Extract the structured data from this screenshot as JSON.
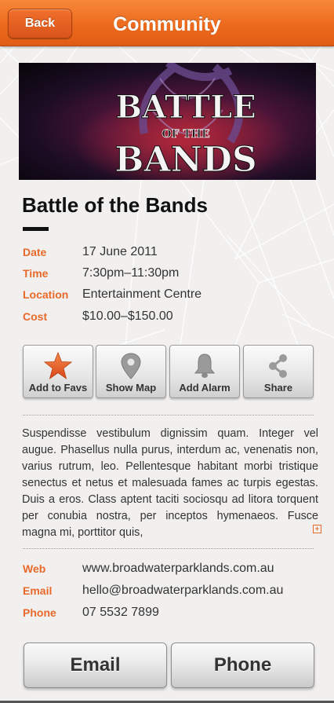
{
  "header": {
    "back_label": "Back",
    "title": "Community"
  },
  "banner": {
    "line1": "BATTLE",
    "line2": "OF THE",
    "line3": "BANDS"
  },
  "event": {
    "title": "Battle of the Bands",
    "details": [
      {
        "label": "Date",
        "value": "17 June 2011"
      },
      {
        "label": "Time",
        "value": "7:30pm–11:30pm"
      },
      {
        "label": "Location",
        "value": "Entertainment Centre"
      },
      {
        "label": "Cost",
        "value": "$10.00–$150.00"
      }
    ]
  },
  "actions": [
    {
      "label": "Add to Favs",
      "icon": "star-icon"
    },
    {
      "label": "Show Map",
      "icon": "map-pin-icon"
    },
    {
      "label": "Add Alarm",
      "icon": "bell-icon"
    },
    {
      "label": "Share",
      "icon": "share-icon"
    }
  ],
  "description": "Suspendisse vestibulum dignissim quam. Integer vel augue. Phasellus nulla purus, interdum ac, venenatis non, varius rutrum, leo. Pellentesque habitant morbi tristique senectus et netus et malesuada fames ac turpis egestas. Duis a eros. Class aptent taciti sociosqu ad litora torquent per conubia nostra, per inceptos hymenaeos. Fusce magna mi, porttitor quis,",
  "contact": [
    {
      "label": "Web",
      "value": "www.broadwaterparklands.com.au"
    },
    {
      "label": "Email",
      "value": "hello@broadwaterparklands.com.au"
    },
    {
      "label": "Phone",
      "value": "07 5532 7899"
    }
  ],
  "buttons": {
    "email": "Email",
    "phone": "Phone"
  },
  "colors": {
    "accent": "#e8692a",
    "header": "#ec6a1d"
  }
}
